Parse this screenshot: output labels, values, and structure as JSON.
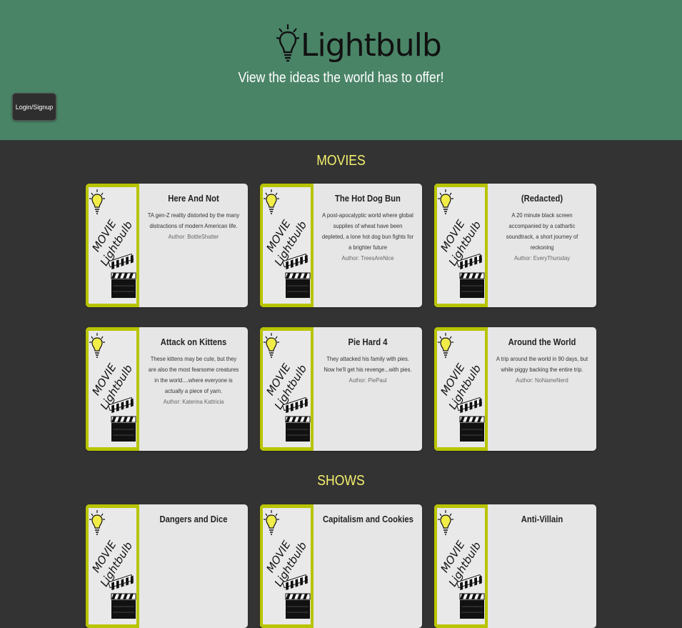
{
  "header": {
    "logo_text": "Lightbulb",
    "tagline": "View the ideas the world has to offer!",
    "login_label": "Login/Signup"
  },
  "poster": {
    "line1": "MOVIE",
    "line2": "Lightbulb",
    "icons": [
      "lightbulb-icon",
      "clapperboard-icon"
    ]
  },
  "colors": {
    "header_bg": "#4a8467",
    "page_bg": "#333333",
    "section_title": "#f5f06e",
    "poster_border": "#b8c400",
    "card_bg": "#e6e6e6"
  },
  "sections": [
    {
      "title": "MOVIES",
      "cards": [
        {
          "title": "Here And Not",
          "description": "TA gen-Z reality distorted by the many distractions of modern American life.",
          "author": "Author: BottleShatter"
        },
        {
          "title": "The Hot Dog Bun",
          "description": "A post-apocalyptic world where global supplies of wheat have been depleted, a lone hot dog bun fights for a brighter future",
          "author": "Author: TreesAreNice"
        },
        {
          "title": "(Redacted)",
          "description": "A 20 minute black screen accompanied by a cathartic soundtrack, a short journey of reckoning",
          "author": "Author: EveryThursday"
        },
        {
          "title": "Attack on Kittens",
          "description": "These kittens may be cute, but they are also the most fearsome creatures in the world....where everyone is actually a piece of yarn.",
          "author": "Author: Katerina Kattricia"
        },
        {
          "title": "Pie Hard 4",
          "description": "They attacked his family with pies. Now he'll get his revenge...with pies.",
          "author": "Author: PiePaul"
        },
        {
          "title": "Around the World",
          "description": "A trip around the world in 90 days, but while piggy backing the entire trip.",
          "author": "Author: NoNameNerd"
        }
      ]
    },
    {
      "title": "SHOWS",
      "cards": [
        {
          "title": "Dangers and Dice",
          "description": "",
          "author": ""
        },
        {
          "title": "Capitalism and Cookies",
          "description": "",
          "author": ""
        },
        {
          "title": "Anti-Villain",
          "description": "",
          "author": ""
        }
      ]
    }
  ]
}
